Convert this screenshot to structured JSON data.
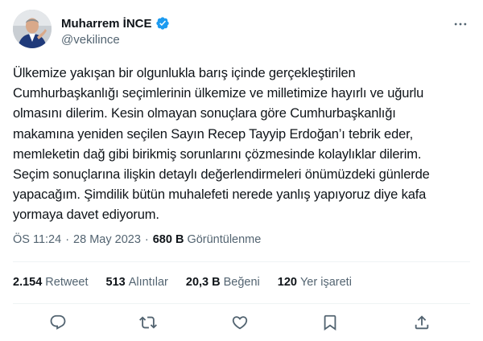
{
  "author": {
    "name": "Muharrem İNCE",
    "handle": "@vekilince",
    "verified": true
  },
  "tweet": {
    "text": "Ülkemize yakışan bir olgunlukla barış içinde gerçekleştirilen\nCumhurbaşkanlığı seçimlerinin ülkemize ve milletimize hayırlı ve uğurlu\nolmasını dilerim. Kesin olmayan sonuçlara göre Cumhurbaşkanlığı\nmakamına yeniden seçilen Sayın Recep Tayyip Erdoğan’ı tebrik eder,\nmemleketin dağ gibi birikmiş sorunlarını çözmesinde kolaylıklar dilerim.\nSeçim sonuçlarına ilişkin detaylı değerlendirmeleri önümüzdeki günlerde\nyapacağım. Şimdilik bütün muhalefeti nerede yanlış yapıyoruz diye kafa\nyormaya davet ediyorum.",
    "time": "ÖS 11:24",
    "separator": "·",
    "date": "28 May 2023",
    "views_count": "680 B",
    "views_label": "Görüntülenme"
  },
  "stats": [
    {
      "value": "2.154",
      "label": "Retweet"
    },
    {
      "value": "513",
      "label": "Alıntılar"
    },
    {
      "value": "20,3 B",
      "label": "Beğeni"
    },
    {
      "value": "120",
      "label": "Yer işareti"
    }
  ],
  "actions": [
    "reply-icon",
    "retweet-icon",
    "like-icon",
    "bookmark-icon",
    "share-icon"
  ],
  "colors": {
    "verified": "#1d9bf0",
    "icon": "#536471",
    "text": "#0f1419",
    "muted": "#536471",
    "divider": "#eff3f4"
  }
}
